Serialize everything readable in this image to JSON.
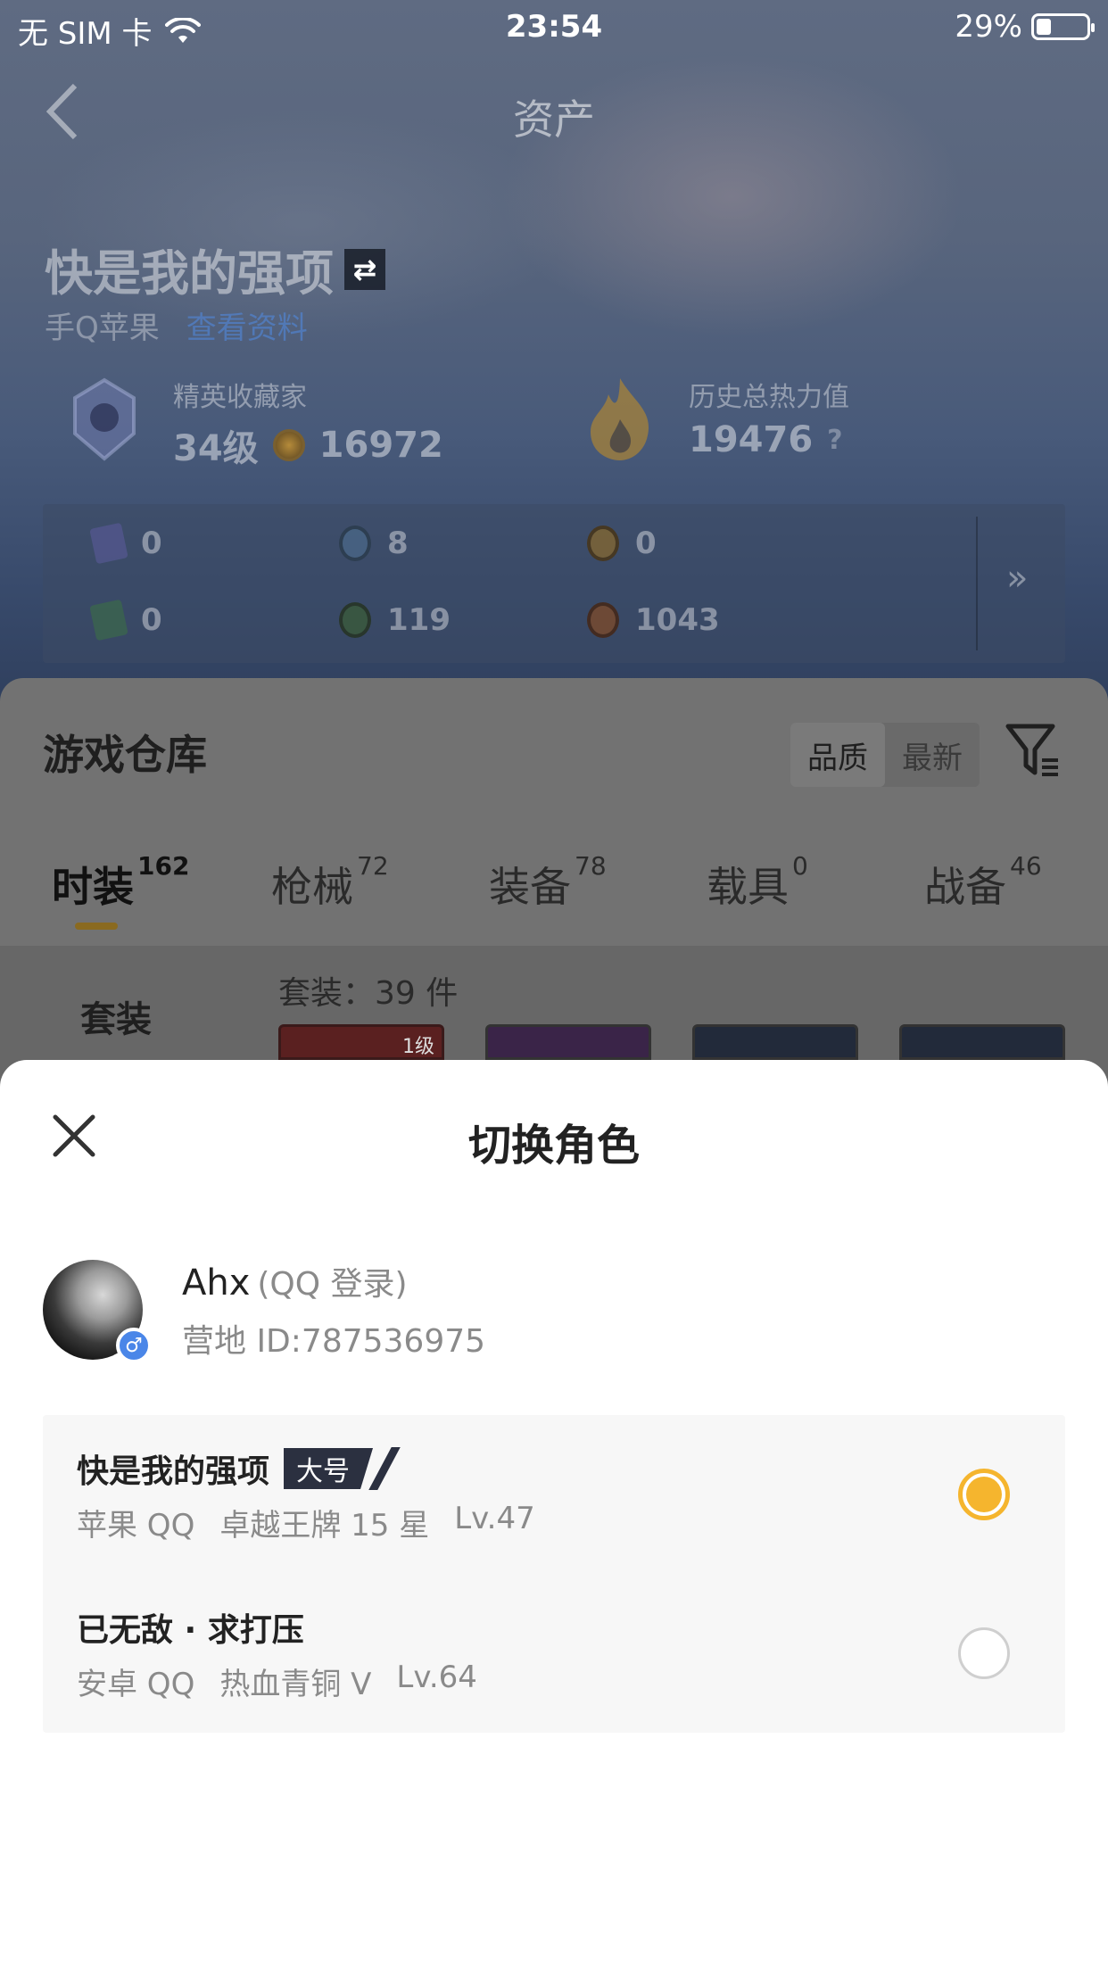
{
  "status_bar": {
    "carrier": "无 SIM 卡",
    "time": "23:54",
    "battery_text": "29%",
    "battery_level": 0.29
  },
  "nav": {
    "title": "资产"
  },
  "profile": {
    "name": "快是我的强项",
    "platform": "手Q苹果",
    "platform_link": "查看资料",
    "collector_label": "精英收藏家",
    "collector_level": "34级",
    "coin_value": "16972",
    "heat_label": "历史总热力值",
    "heat_value": "19476",
    "heat_help": "?"
  },
  "resources": [
    {
      "value": "0",
      "icon": "card-icon",
      "color": "#5a5a9a"
    },
    {
      "value": "8",
      "icon": "token-icon",
      "color": "#4a6a8a"
    },
    {
      "value": "0",
      "icon": "medal-icon",
      "color": "#8a6a2a"
    },
    {
      "value": "0",
      "icon": "green-card-icon",
      "color": "#3a6a4a"
    },
    {
      "value": "119",
      "icon": "orb-icon",
      "color": "#3a5a3a"
    },
    {
      "value": "1043",
      "icon": "bronze-coin-icon",
      "color": "#7a4a2a"
    }
  ],
  "resources_more": "»",
  "warehouse": {
    "title": "游戏仓库",
    "sort_quality": "品质",
    "sort_newest": "最新",
    "tabs": [
      {
        "label": "时装",
        "count": "162"
      },
      {
        "label": "枪械",
        "count": "72"
      },
      {
        "label": "装备",
        "count": "78"
      },
      {
        "label": "载具",
        "count": "0"
      },
      {
        "label": "战备",
        "count": "46"
      }
    ],
    "side_item": "套装",
    "count_label": "套装：39 件",
    "first_thumb_badge": "1级"
  },
  "sheet": {
    "title": "切换角色",
    "user": {
      "name": "Ahx",
      "login": "(QQ 登录)",
      "camp_id": "营地 ID:787536975",
      "gender_symbol": "♂"
    },
    "roles": [
      {
        "name": "快是我的强项",
        "tag": "大号",
        "platform": "苹果 QQ",
        "rank": "卓越王牌 15 星",
        "level": "Lv.47",
        "selected": true
      },
      {
        "name": "已无敌 · 求打压",
        "tag": "",
        "platform": "安卓 QQ",
        "rank": "热血青铜 V",
        "level": "Lv.64",
        "selected": false
      }
    ]
  },
  "colors": {
    "accent": "#f5b52e",
    "tag_bg": "#2b3040",
    "gender": "#4a86e8"
  }
}
